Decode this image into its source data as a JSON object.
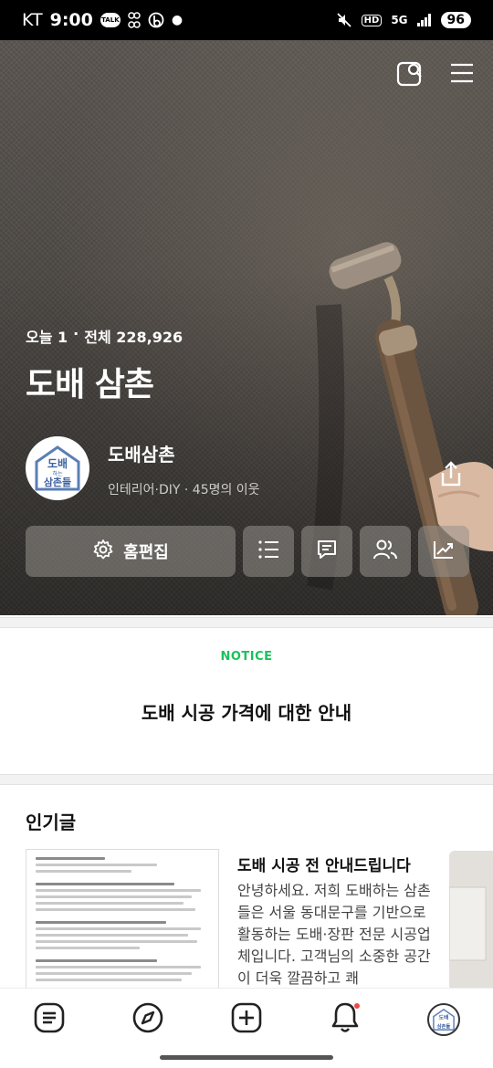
{
  "status_bar": {
    "carrier": "KT",
    "time": "9:00",
    "talk_badge": "TALK",
    "network": "5G",
    "hd_badge": "HD",
    "battery": "96"
  },
  "hero": {
    "visits_today_label": "오늘 1",
    "separator": "·",
    "visits_total_label": "전체 228,926",
    "blog_title": "도배 삼촌",
    "profile": {
      "name": "도배삼촌",
      "meta": "인테리어·DIY · 45명의 이웃",
      "avatar_text_top": "도배",
      "avatar_text_small": "하는",
      "avatar_text_bottom": "삼촌들"
    },
    "edit_button_label": "홈편집"
  },
  "notice": {
    "label": "NOTICE",
    "title": "도배 시공 가격에 대한 안내"
  },
  "popular": {
    "section_title": "인기글",
    "posts": [
      {
        "title": "도배 시공 전 안내드립니다",
        "excerpt": "안녕하세요. 저희 도배하는 삼촌들은 서울 동대문구를 기반으로 활동하는 도배·장판 전문 시공업체입니다. 고객님의 소중한 공간이 더욱 깔끔하고 쾌"
      }
    ]
  },
  "bottom_nav": {
    "items": [
      "posts-icon",
      "compass-icon",
      "write-icon",
      "bell-icon",
      "profile-avatar"
    ],
    "has_notification": true
  },
  "colors": {
    "accent_green": "#19c25a",
    "notification_red": "#f04848"
  }
}
